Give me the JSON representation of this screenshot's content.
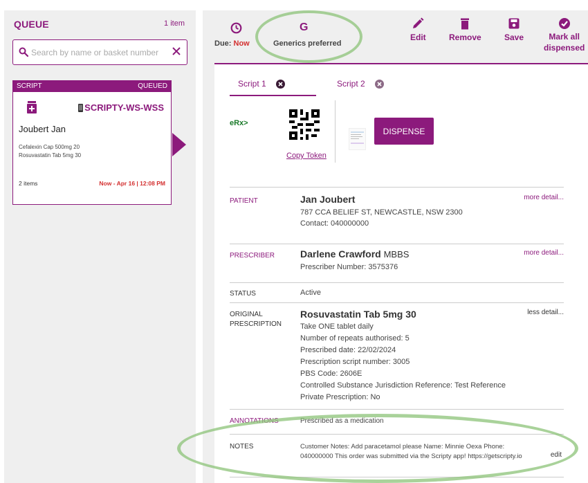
{
  "queue": {
    "title": "QUEUE",
    "count": "1 item",
    "search_placeholder": "Search by name or basket number",
    "card": {
      "type": "SCRIPT",
      "status": "QUEUED",
      "app": "SCRIPTY-WS-WSS",
      "patient": "Joubert Jan",
      "meds": [
        "Cefalexin Cap 500mg 20",
        "Rosuvastatin Tab 5mg 30"
      ],
      "items": "2 items",
      "due": "Now - Apr 16 | 12:08 PM"
    }
  },
  "toolbar": {
    "due_label": "Due:",
    "due_value": "Now",
    "generics_icon": "G",
    "generics_label": "Generics preferred",
    "edit": "Edit",
    "remove": "Remove",
    "save": "Save",
    "mark_all_1": "Mark all",
    "mark_all_2": "dispensed"
  },
  "tabs": [
    {
      "label": "Script 1"
    },
    {
      "label": "Script 2"
    }
  ],
  "erx": {
    "label": "eRx>",
    "copy_token": "Copy Token",
    "dispense": "DISPENSE"
  },
  "patient": {
    "label": "PATIENT",
    "name": "Jan Joubert",
    "address": "787 CCA BELIEF ST, NEWCASTLE, NSW 2300",
    "contact": "Contact: 040000000",
    "more": "more detail..."
  },
  "prescriber": {
    "label": "PRESCRIBER",
    "name": "Darlene Crawford",
    "title": "MBBS",
    "number": "Prescriber Number: 3575376",
    "more": "more detail..."
  },
  "status": {
    "label": "STATUS",
    "value": "Active"
  },
  "original": {
    "label_1": "ORIGINAL",
    "label_2": "PRESCRIPTION",
    "drug": "Rosuvastatin Tab 5mg 30",
    "less": "less detail...",
    "lines": [
      "Take ONE tablet daily",
      "Number of repeats authorised: 5",
      "Prescribed date: 22/02/2024",
      "Prescription script number: 3005",
      "PBS Code: 2606E",
      "Controlled Substance Jurisdiction Reference: Test Reference",
      "Private Prescription: No"
    ]
  },
  "annotations": {
    "label": "ANNOTATIONS",
    "value": "Prescribed as a medication"
  },
  "notes": {
    "label": "NOTES",
    "text": "Customer Notes: Add paracetamol please Name: Minnie Oexa Phone: 040000000 This order was submitted via the Scripty app! https://getscripty.io",
    "edit": "edit"
  },
  "colors": {
    "brand": "#8c1a7c",
    "due": "#d32f2f",
    "erx_green": "#1a7a2a",
    "highlight_ring": "#8cc378"
  }
}
